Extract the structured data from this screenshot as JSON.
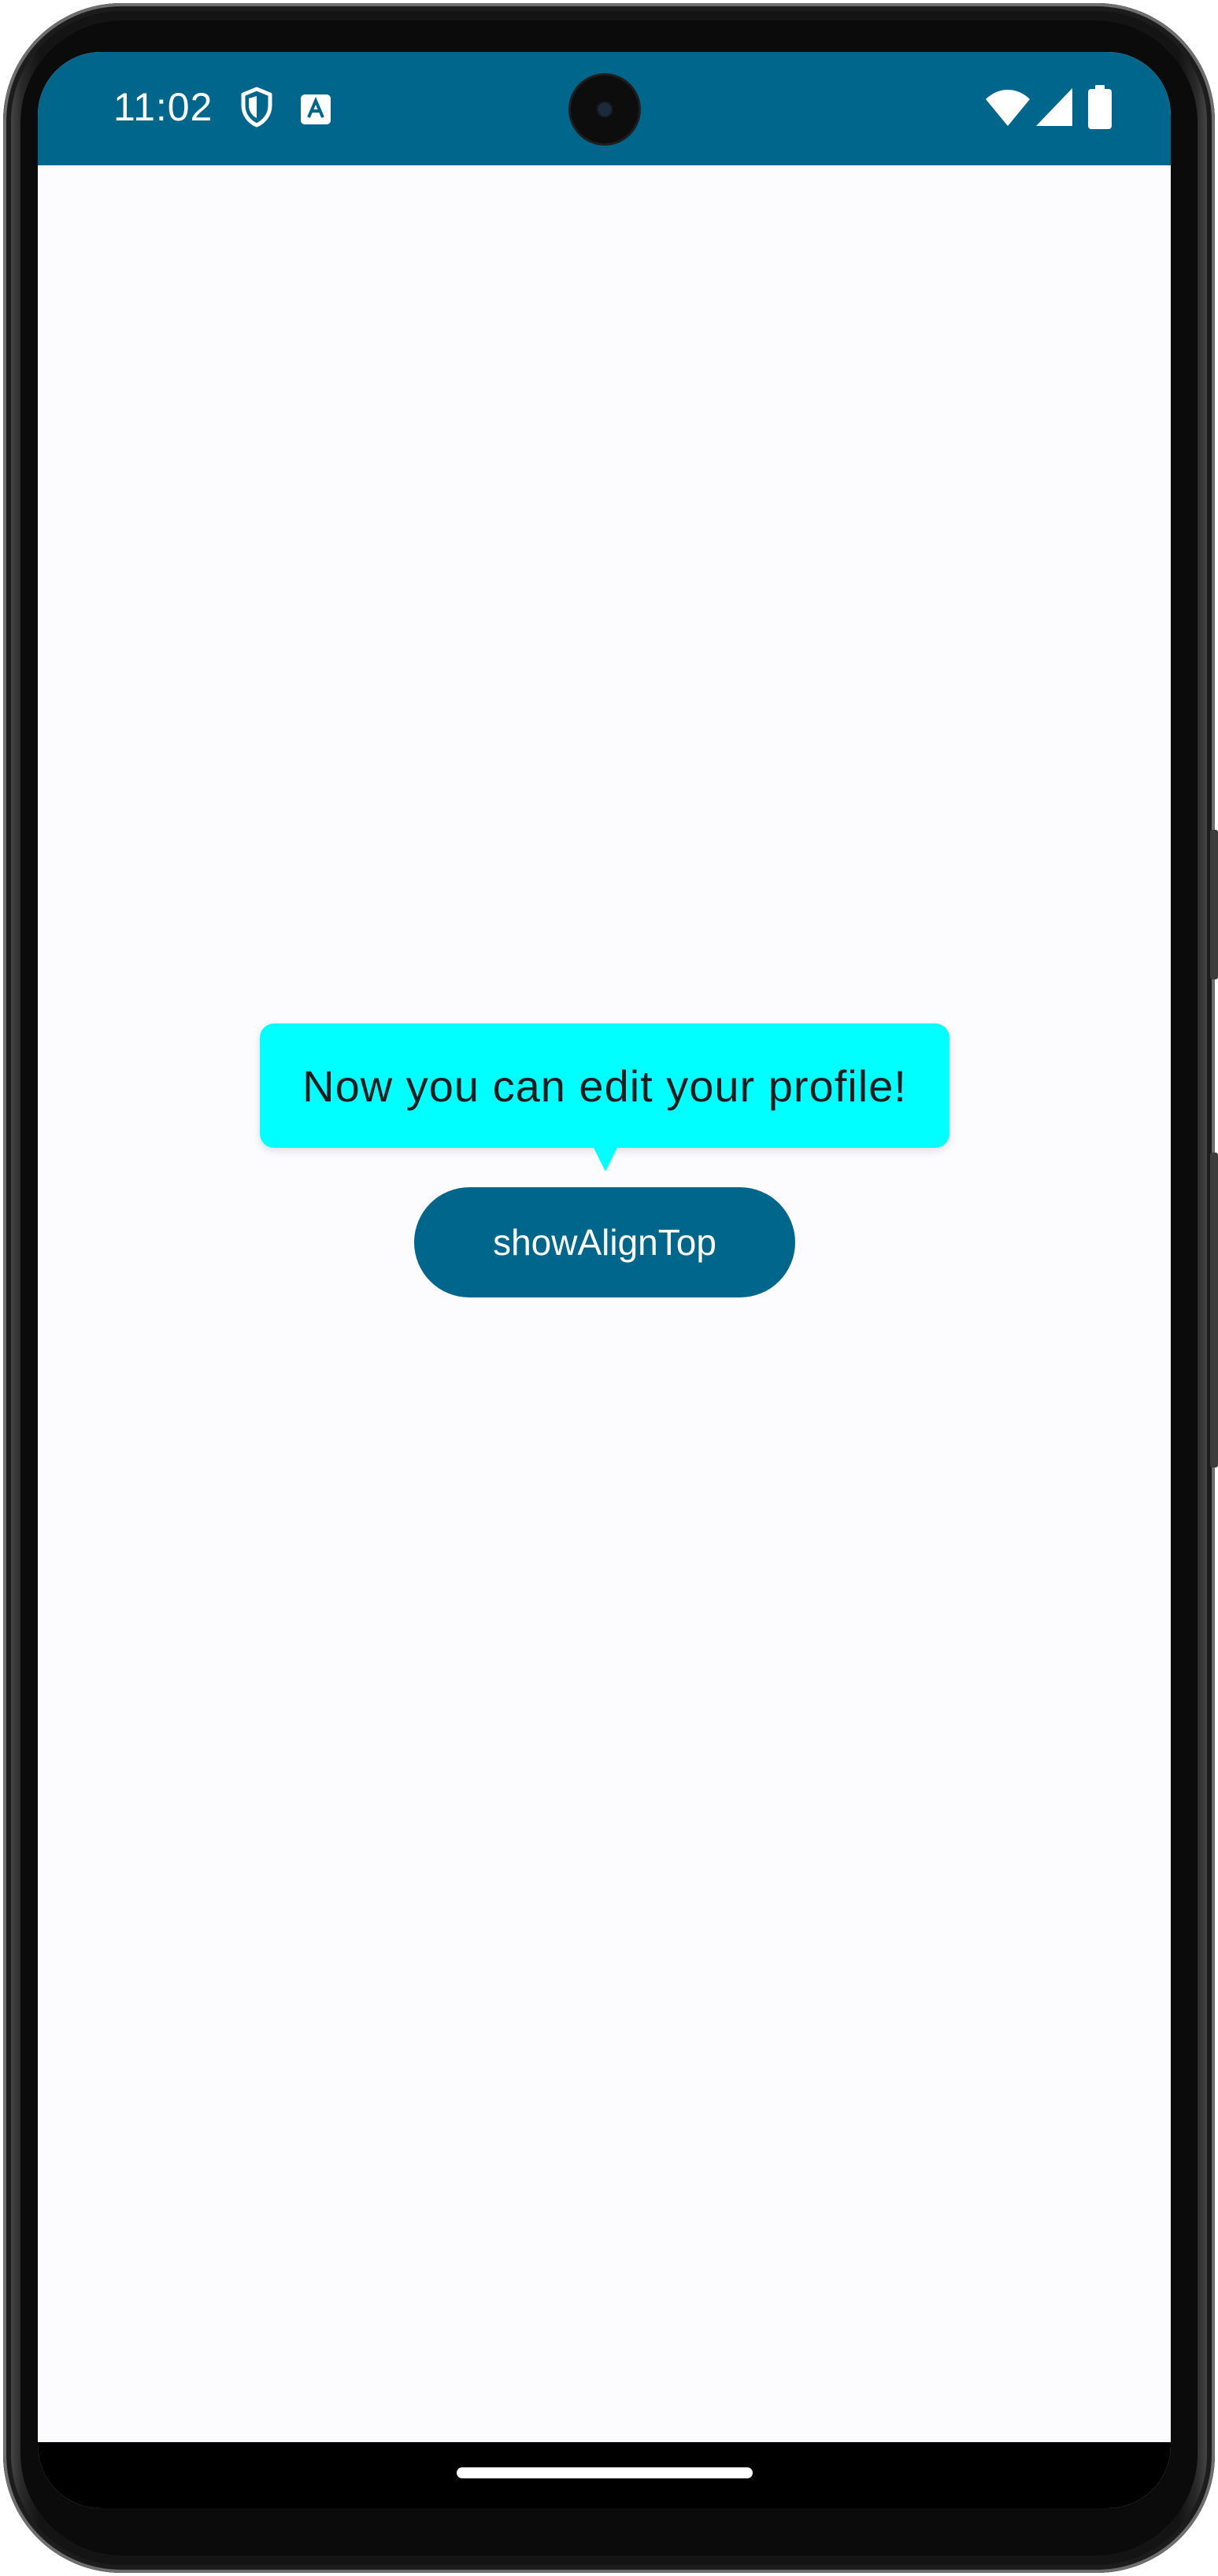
{
  "status_bar": {
    "time": "11:02",
    "background_color": "#01668b",
    "left_icons": [
      "shield-icon",
      "keyboard-a-icon"
    ],
    "right_icons": [
      "wifi-icon",
      "cellular-signal-icon",
      "battery-icon"
    ]
  },
  "tooltip": {
    "text": "Now you can edit your profile!",
    "background_color": "#00ffff",
    "text_color": "#1c1c1e"
  },
  "main_button": {
    "label": "showAlignTop",
    "background_color": "#01668b",
    "text_color": "#ffffff"
  },
  "navigation": {
    "home_handle_icon": "gesture-home-handle"
  },
  "screen": {
    "background_color": "#fcfcff"
  }
}
